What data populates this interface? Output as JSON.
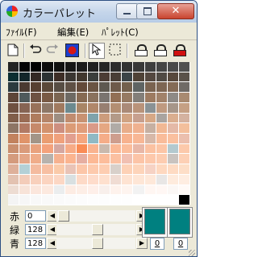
{
  "window": {
    "title": "カラーパレット",
    "close_symbol": "✕"
  },
  "menu": {
    "items": [
      {
        "label": "ﾌｧｲﾙ(F)"
      },
      {
        "label": "編集(E)"
      },
      {
        "label": "ﾊﾟﾚｯﾄ(C)"
      }
    ]
  },
  "toolbar": {
    "icons": [
      "new-document-icon",
      "undo-icon",
      "redo-icon",
      "color-swap-icon",
      "pointer-icon",
      "rectangle-select-icon",
      "lock-open-icon",
      "lock-closed-icon",
      "lock-red-icon"
    ]
  },
  "palette": {
    "columns": 16,
    "rows": 14,
    "colors": [
      [
        "#232323",
        "#050505",
        "#000000",
        "#0c0c0c",
        "#101010",
        "#151515",
        "#1a1a1a",
        "#202020",
        "#262626",
        "#2c2c2c",
        "#323232",
        "#383838",
        "#3e3e3e",
        "#444444",
        "#4a4a4a",
        "#505050"
      ],
      [
        "#0c2e32",
        "#13262a",
        "#332824",
        "#2c3233",
        "#3d2e27",
        "#3a3632",
        "#40372e",
        "#3b3e3c",
        "#4c3d35",
        "#493e36",
        "#3c4447",
        "#4f4237",
        "#544840",
        "#504a44",
        "#57483c",
        "#5a524a"
      ],
      [
        "#2b3a3e",
        "#4a3a31",
        "#563f31",
        "#5a4839",
        "#574d44",
        "#5f5045",
        "#634a3a",
        "#6a5443",
        "#5e5850",
        "#6e5a4a",
        "#73604d",
        "#5f6463",
        "#7a6350",
        "#7d6653",
        "#846b56",
        "#6f6a66"
      ],
      [
        "#5d4538",
        "#4f5a5c",
        "#6e5243",
        "#795a45",
        "#7b6552",
        "#6e6a64",
        "#866a53",
        "#8a725e",
        "#7a7470",
        "#926f55",
        "#967a63",
        "#837f7a",
        "#9d7b61",
        "#a1826a",
        "#8e8a86",
        "#a88a71"
      ],
      [
        "#6f5141",
        "#866454",
        "#98715a",
        "#8d7767",
        "#a07a5f",
        "#6c8a8f",
        "#a88566",
        "#b0876a",
        "#977f71",
        "#b38e72",
        "#aa8a78",
        "#b9937a",
        "#8a9295",
        "#bf9a80",
        "#a69689",
        "#c5a084"
      ],
      [
        "#805e4a",
        "#9a6c55",
        "#af7c5e",
        "#b5856a",
        "#9d8e82",
        "#c08c6f",
        "#c89272",
        "#7fa3ab",
        "#cc9c7c",
        "#b39a88",
        "#d0a383",
        "#c7a08f",
        "#d6a886",
        "#a9a4a0",
        "#daae8f",
        "#d4b2a0"
      ],
      [
        "#8d7565",
        "#b27a64",
        "#c6896a",
        "#d2926e",
        "#cd8f80",
        "#db9b76",
        "#e09d7a",
        "#d99a88",
        "#e5a782",
        "#b0aba6",
        "#e8ad8a",
        "#efb190",
        "#c6b0a2",
        "#f1b894",
        "#e4b9a7",
        "#f3bf9c"
      ],
      [
        "#c2825e",
        "#e0946a",
        "#a39588",
        "#ea9d71",
        "#f0a17c",
        "#e29f8f",
        "#f4a67f",
        "#8fb9c4",
        "#f5ad88",
        "#ce9e8e",
        "#f7b28e",
        "#f8b795",
        "#d7b8a8",
        "#f9bc9a",
        "#fac09f",
        "#ebbfae"
      ],
      [
        "#c98f6f",
        "#da9b7b",
        "#e9a27e",
        "#f4a27c",
        "#d5a7a0",
        "#f7ab86",
        "#fa8c55",
        "#f9b38f",
        "#c9b9ad",
        "#fab895",
        "#fbbd9b",
        "#e8b7a7",
        "#fbc1a1",
        "#fcc5a6",
        "#b3c9cf",
        "#fcc9ab"
      ],
      [
        "#d49b7d",
        "#e4a687",
        "#f0ad8a",
        "#b7b2ad",
        "#f6b18f",
        "#fbb48f",
        "#e6aea1",
        "#fcb995",
        "#fcbd9b",
        "#fbc0a1",
        "#f1c0b2",
        "#fcc4a7",
        "#fdc8ab",
        "#fdccb0",
        "#c9c3bf",
        "#fdd0b5"
      ],
      [
        "#deb09a",
        "#b4d0d6",
        "#f4bb9f",
        "#f7bfa2",
        "#facaa9",
        "#e9c3b6",
        "#fcc6a8",
        "#fdcaad",
        "#fdcdb1",
        "#d8d0ca",
        "#fdd1b6",
        "#fdd4ba",
        "#f6d2c4",
        "#fed8bf",
        "#fedbc3",
        "#fddec7"
      ],
      [
        "#e3c2b1",
        "#f3ccb9",
        "#f8d0bc",
        "#fbd4c0",
        "#fcd7c4",
        "#d9e0e1",
        "#fddac7",
        "#fedccb",
        "#fee0ce",
        "#f0dcd3",
        "#fee3d2",
        "#fee6d6",
        "#fee8d9",
        "#e8e6e5",
        "#feebdd",
        "#feede1"
      ],
      [
        "#eddcd2",
        "#f7e3d8",
        "#fbe6dc",
        "#fce9df",
        "#ebedee",
        "#fdece3",
        "#fdeee6",
        "#feefe9",
        "#f8efeb",
        "#fef2ec",
        "#fef4ef",
        "#f2f2f2",
        "#fff6f2",
        "#fff7f4",
        "#fbf7f5",
        "#fffaf7"
      ],
      [
        "#f4f4f4",
        "#f6f6f6",
        "#f8f8f8",
        "#f9f9f9",
        "#fafafa",
        "#fbfbfb",
        "#fcfcfc",
        "#fdfdfd",
        "#fdfdfd",
        "#fefefe",
        "#fefefe",
        "#ffffff",
        "#ffffff",
        "#ffffff",
        "#ffffff",
        "#000000"
      ]
    ]
  },
  "sliders": [
    {
      "label": "赤",
      "value": "0",
      "level": 0.0
    },
    {
      "label": "緑",
      "value": "128",
      "level": 0.5
    },
    {
      "label": "青",
      "value": "128",
      "level": 0.5
    }
  ],
  "swatches": [
    {
      "color": "#008080",
      "index": "0"
    },
    {
      "color": "#008080",
      "index": "0"
    }
  ]
}
